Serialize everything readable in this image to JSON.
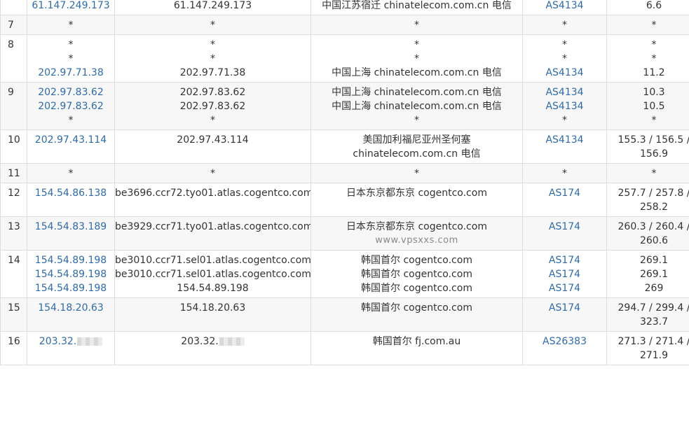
{
  "rows": [
    {
      "hop": "",
      "ip": [
        "61.147.249.173"
      ],
      "host": [
        "61.147.249.173"
      ],
      "geo": [
        "中国江苏宿迁 chinatelecom.com.cn 电信"
      ],
      "asn": [
        "AS4134"
      ],
      "rtt": [
        "6.6"
      ]
    },
    {
      "hop": "7",
      "ip": [
        "*"
      ],
      "host": [
        "*"
      ],
      "geo": [
        "*"
      ],
      "asn": [
        "*"
      ],
      "rtt": [
        "*"
      ]
    },
    {
      "hop": "8",
      "ip": [
        "*",
        "*",
        "202.97.71.38"
      ],
      "host": [
        "*",
        "*",
        "202.97.71.38"
      ],
      "geo": [
        "*",
        "*",
        "中国上海 chinatelecom.com.cn 电信"
      ],
      "asn": [
        "*",
        "*",
        "AS4134"
      ],
      "rtt": [
        "*",
        "*",
        "11.2"
      ]
    },
    {
      "hop": "9",
      "ip": [
        "202.97.83.62",
        "202.97.83.62",
        "*"
      ],
      "host": [
        "202.97.83.62",
        "202.97.83.62",
        "*"
      ],
      "geo": [
        "中国上海 chinatelecom.com.cn 电信",
        "中国上海 chinatelecom.com.cn 电信",
        "*"
      ],
      "asn": [
        "AS4134",
        "AS4134",
        "*"
      ],
      "rtt": [
        "10.3",
        "10.5",
        "*"
      ]
    },
    {
      "hop": "10",
      "ip": [
        "202.97.43.114"
      ],
      "host": [
        "202.97.43.114"
      ],
      "geo": [
        "美国加利福尼亚州圣何塞",
        "chinatelecom.com.cn 电信"
      ],
      "asn": [
        "AS4134"
      ],
      "rtt": [
        "155.3 / 156.5 /",
        "156.9"
      ]
    },
    {
      "hop": "11",
      "ip": [
        "*"
      ],
      "host": [
        "*"
      ],
      "geo": [
        "*"
      ],
      "asn": [
        "*"
      ],
      "rtt": [
        "*"
      ]
    },
    {
      "hop": "12",
      "ip": [
        "154.54.86.138"
      ],
      "host": [
        "be3696.ccr72.tyo01.atlas.cogentco.com"
      ],
      "geo": [
        "日本东京都东京 cogentco.com"
      ],
      "asn": [
        "AS174"
      ],
      "rtt": [
        "257.7 / 257.8 /",
        "258.2"
      ]
    },
    {
      "hop": "13",
      "ip": [
        "154.54.83.189"
      ],
      "host": [
        "be3929.ccr71.tyo01.atlas.cogentco.com"
      ],
      "geo": [
        "日本东京都东京 cogentco.com"
      ],
      "watermark": "www.vpsxxs.com",
      "asn": [
        "AS174"
      ],
      "rtt": [
        "260.3 / 260.4 /",
        "260.6"
      ]
    },
    {
      "hop": "14",
      "ip": [
        "154.54.89.198",
        "154.54.89.198",
        "154.54.89.198"
      ],
      "host": [
        "be3010.ccr71.sel01.atlas.cogentco.com",
        "be3010.ccr71.sel01.atlas.cogentco.com",
        "154.54.89.198"
      ],
      "geo": [
        "韩国首尔 cogentco.com",
        "韩国首尔 cogentco.com",
        "韩国首尔 cogentco.com"
      ],
      "asn": [
        "AS174",
        "AS174",
        "AS174"
      ],
      "rtt": [
        "269.1",
        "269.1",
        "269"
      ]
    },
    {
      "hop": "15",
      "ip": [
        "154.18.20.63"
      ],
      "host": [
        "154.18.20.63"
      ],
      "geo": [
        "韩国首尔 cogentco.com"
      ],
      "asn": [
        "AS174"
      ],
      "rtt": [
        "294.7 / 299.4 /",
        "323.7"
      ]
    },
    {
      "hop": "16",
      "ip": [
        "203.32."
      ],
      "ip_masked": true,
      "host": [
        "203.32."
      ],
      "host_masked": true,
      "geo": [
        "韩国首尔 fj.com.au"
      ],
      "asn": [
        "AS26383"
      ],
      "rtt": [
        "271.3 / 271.4 /",
        "271.9"
      ]
    }
  ]
}
